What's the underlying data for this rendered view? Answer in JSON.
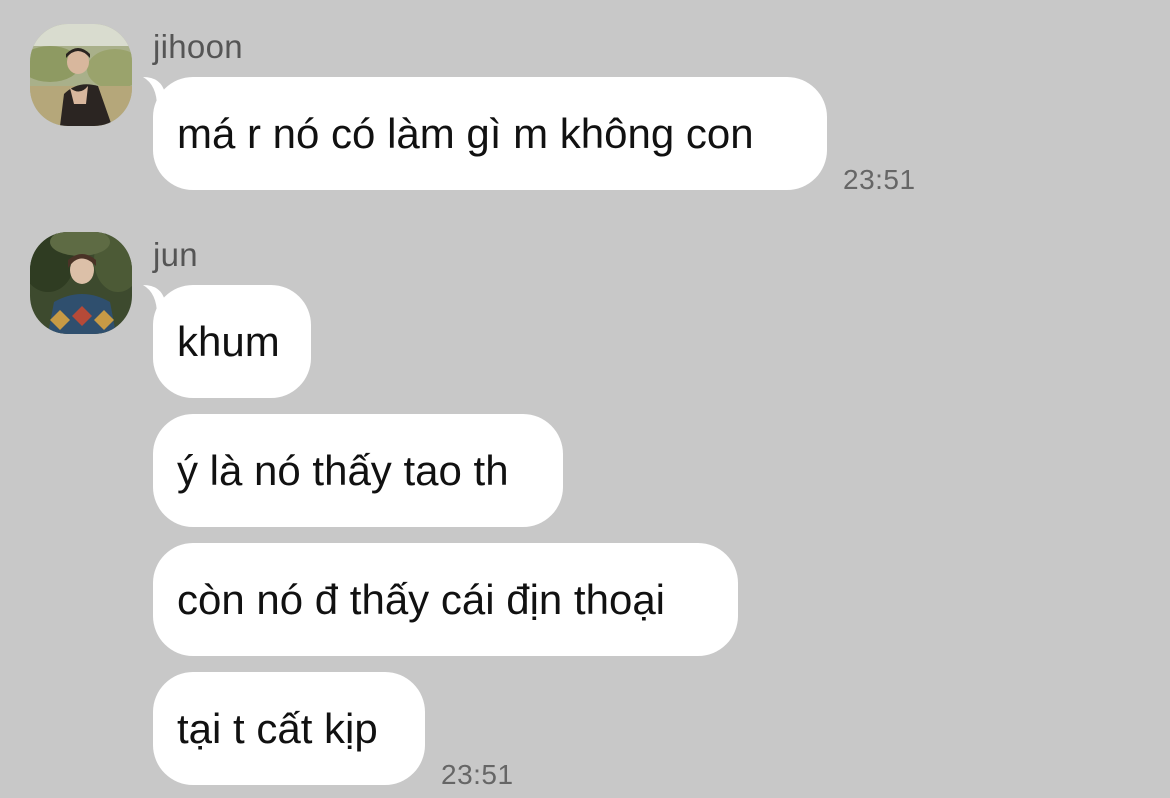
{
  "messages": [
    {
      "sender": "jihoon",
      "avatar_icon": "user-avatar-icon",
      "bubbles": [
        "má r nó có làm gì m không con"
      ],
      "time": "23:51"
    },
    {
      "sender": "jun",
      "avatar_icon": "user-avatar-icon",
      "bubbles": [
        "khum",
        "ý là nó thấy tao th",
        "còn nó đ thấy cái địn thoại",
        "tại t cất kịp"
      ],
      "time": "23:51"
    }
  ],
  "colors": {
    "background": "#c8c8c8",
    "bubble": "#ffffff",
    "text": "#111111",
    "meta_text": "#666666"
  }
}
